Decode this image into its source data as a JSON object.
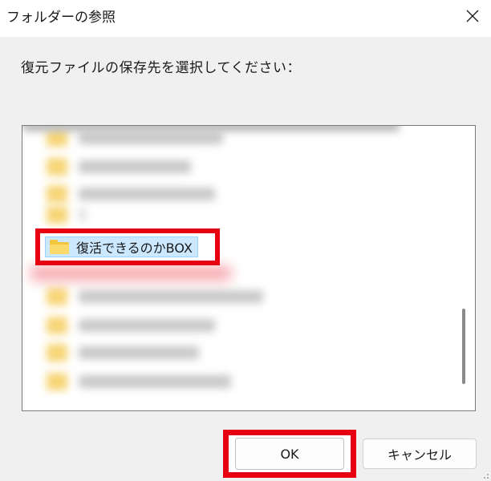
{
  "window": {
    "title": "フォルダーの参照",
    "close_icon": "close-icon"
  },
  "instruction": "復元ファイルの保存先を選択してください：",
  "tree": {
    "selected_item": {
      "label": "復活できるのかBOX",
      "icon": "folder-icon"
    }
  },
  "buttons": {
    "ok_label": "OK",
    "cancel_label": "キャンセル"
  },
  "colors": {
    "highlight_red": "#e60012",
    "selection_blue": "#cce8ff",
    "folder_yellow": "#f7d576"
  }
}
